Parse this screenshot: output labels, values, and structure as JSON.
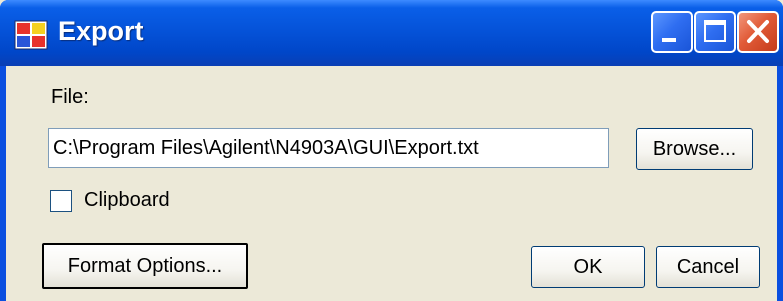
{
  "window": {
    "title": "Export",
    "controls": {
      "minimize": "minimize-icon",
      "maximize": "maximize-icon",
      "close": "close-icon"
    }
  },
  "form": {
    "file_label": "File:",
    "file_path": "C:\\Program Files\\Agilent\\N4903A\\GUI\\Export.txt",
    "browse_label": "Browse...",
    "clipboard_label": "Clipboard",
    "clipboard_checked": false,
    "format_options_label": "Format Options...",
    "ok_label": "OK",
    "cancel_label": "Cancel"
  },
  "colors": {
    "titlebar": "#0553d9",
    "client": "#ece9d8",
    "close_button": "#e15b38"
  }
}
